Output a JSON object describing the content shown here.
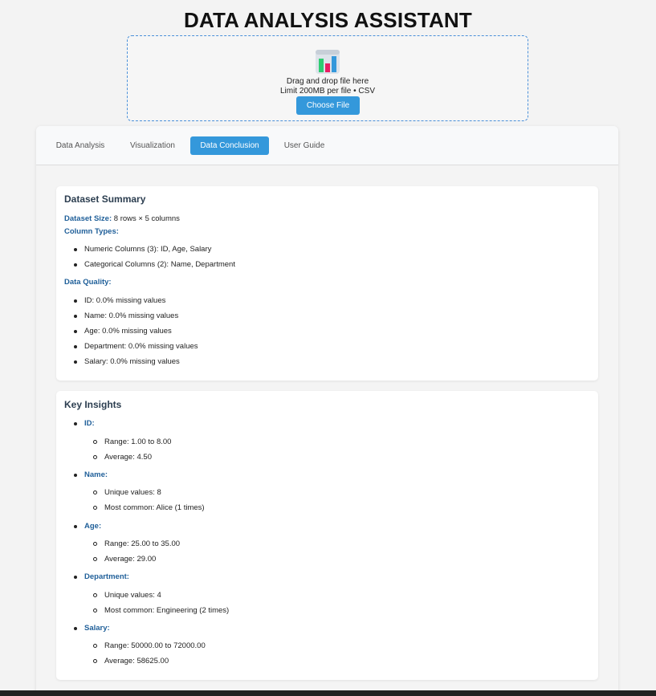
{
  "header": {
    "title": "DATA ANALYSIS ASSISTANT"
  },
  "upload": {
    "icon": "bar-chart-icon",
    "drag_text": "Drag and drop file here",
    "limit_text": "Limit 200MB per file • CSV",
    "choose_label": "Choose File"
  },
  "tabs": [
    {
      "label": "Data Analysis",
      "active": false
    },
    {
      "label": "Visualization",
      "active": false
    },
    {
      "label": "Data Conclusion",
      "active": true
    },
    {
      "label": "User Guide",
      "active": false
    }
  ],
  "summary": {
    "title": "Dataset Summary",
    "size_label": "Dataset Size:",
    "size_value": "8 rows × 5 columns",
    "types_label": "Column Types:",
    "types": [
      "Numeric Columns (3): ID, Age, Salary",
      "Categorical Columns (2): Name, Department"
    ],
    "quality_label": "Data Quality:",
    "quality": [
      "ID: 0.0% missing values",
      "Name: 0.0% missing values",
      "Age: 0.0% missing values",
      "Department: 0.0% missing values",
      "Salary: 0.0% missing values"
    ]
  },
  "insights": {
    "title": "Key Insights",
    "columns": [
      {
        "name": "ID:",
        "items": [
          "Range: 1.00 to 8.00",
          "Average: 4.50"
        ]
      },
      {
        "name": "Name:",
        "items": [
          "Unique values: 8",
          "Most common: Alice (1 times)"
        ]
      },
      {
        "name": "Age:",
        "items": [
          "Range: 25.00 to 35.00",
          "Average: 29.00"
        ]
      },
      {
        "name": "Department:",
        "items": [
          "Unique values: 4",
          "Most common: Engineering (2 times)"
        ]
      },
      {
        "name": "Salary:",
        "items": [
          "Range: 50000.00 to 72000.00",
          "Average: 58625.00"
        ]
      }
    ]
  },
  "colors": {
    "accent": "#3498db",
    "label_blue": "#1f5f99",
    "heading": "#2c3e50"
  }
}
